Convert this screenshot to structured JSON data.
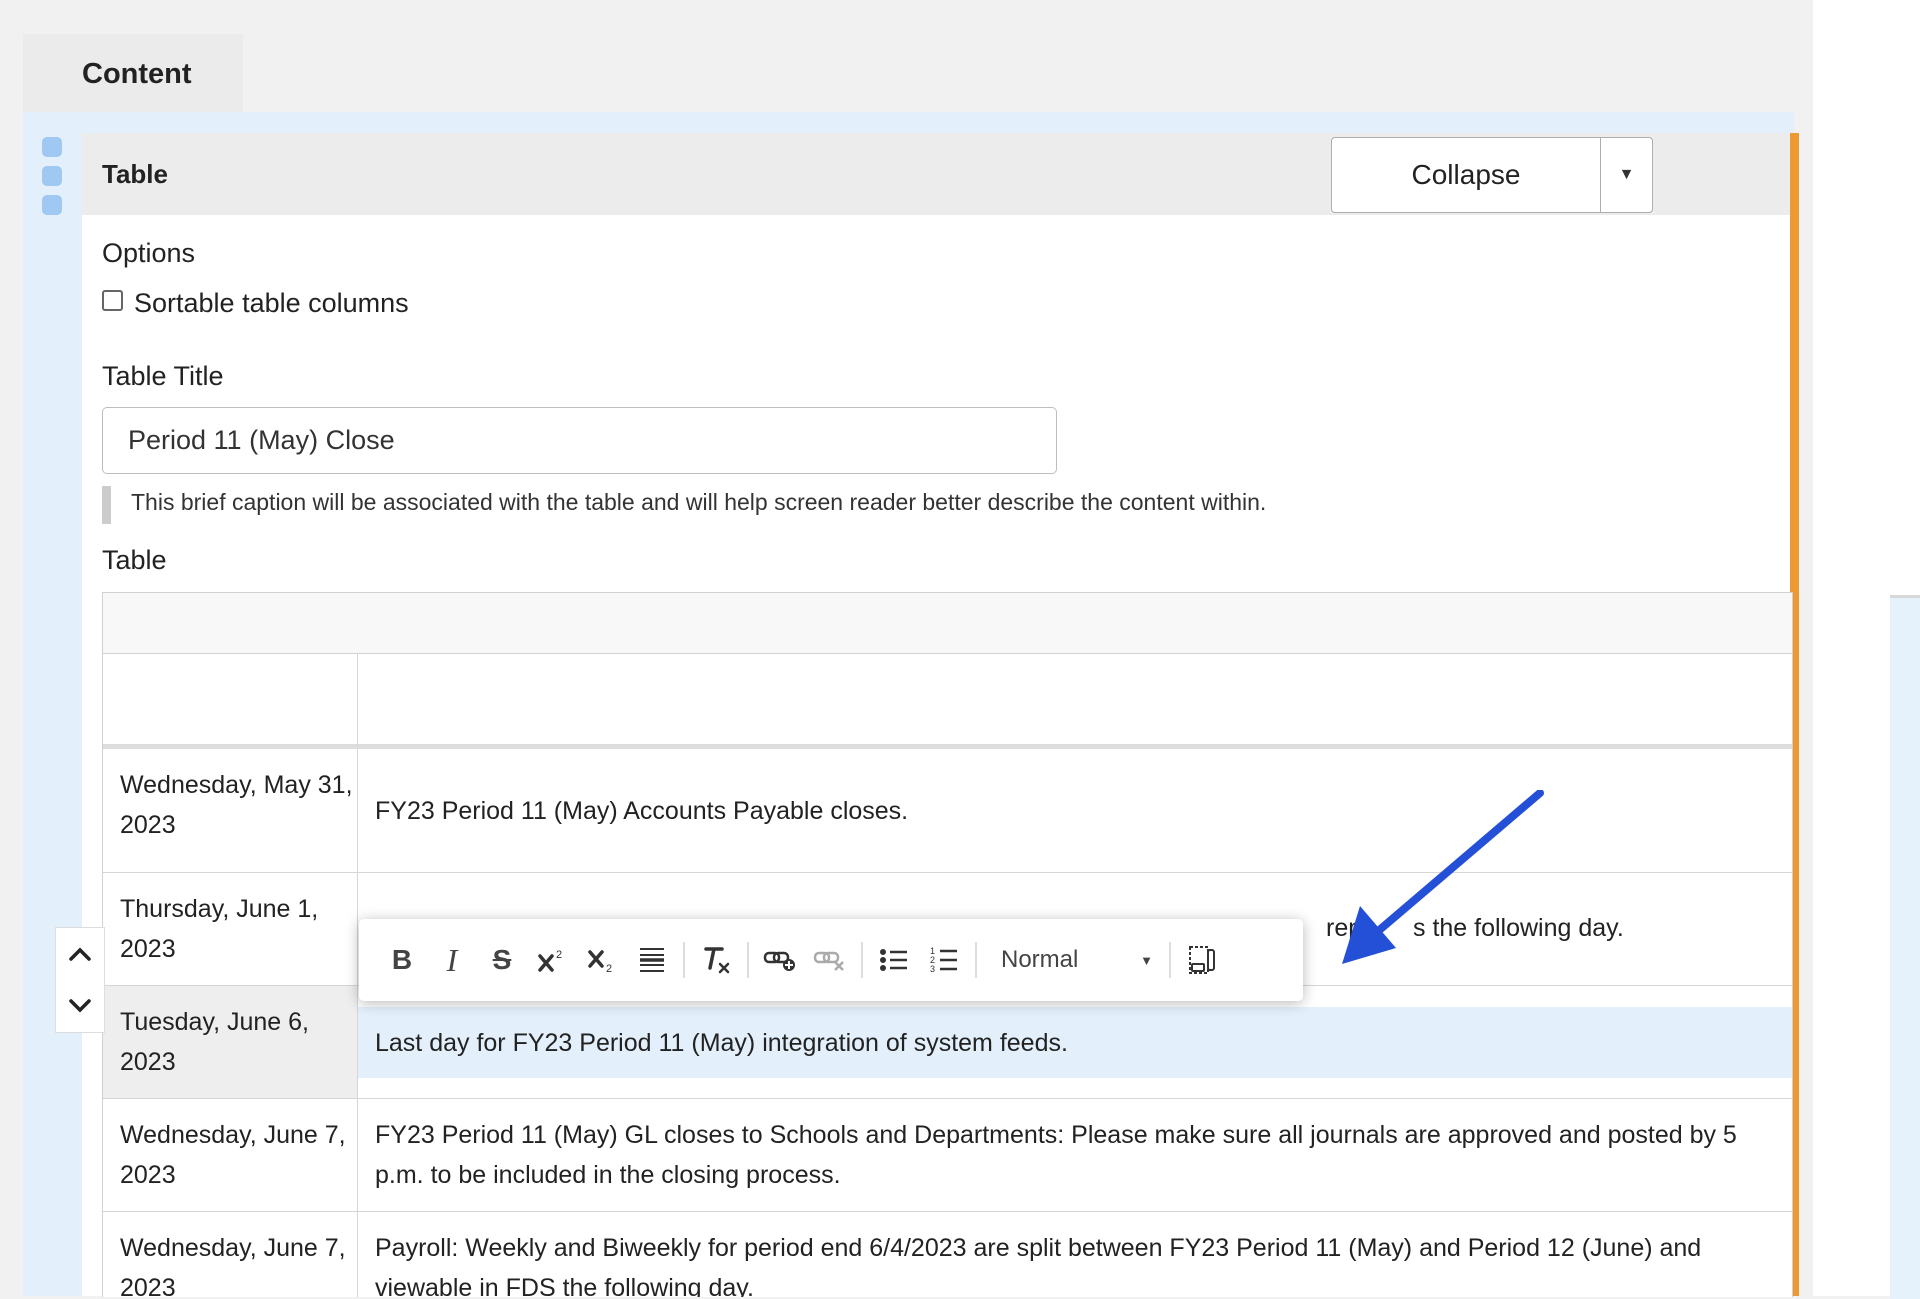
{
  "tabs": {
    "content": "Content"
  },
  "panel": {
    "title": "Table",
    "collapse_label": "Collapse"
  },
  "options": {
    "heading": "Options",
    "sortable_label": "Sortable table columns",
    "sortable_checked": false
  },
  "table_title": {
    "label": "Table Title",
    "value": "Period 11 (May) Close",
    "help": "This brief caption will be associated with the table and will help screen reader better describe the content within."
  },
  "table": {
    "label": "Table",
    "rows": [
      {
        "date": "Wednesday, May 31, 2023",
        "text": "FY23 Period 11 (May) Accounts Payable closes."
      },
      {
        "date": "Thursday, June 1, 2023",
        "text": "s the following day."
      },
      {
        "date": "Tuesday, June 6, 2023",
        "text": "Last day for FY23 Period 11 (May) integration of system feeds."
      },
      {
        "date": "Wednesday, June 7, 2023",
        "text": "FY23 Period 11 (May) GL closes to Schools and Departments: Please make sure all journals are approved and posted by 5 p.m. to be included in the closing process."
      },
      {
        "date": "Wednesday, June 7, 2023",
        "text": "Payroll: Weekly and Biweekly for period end 6/4/2023 are split between FY23 Period 11 (May) and Period 12 (June) and viewable in FDS the following day."
      }
    ],
    "partial_row2_fragment": "rep"
  },
  "toolbar": {
    "bold": "B",
    "italic": "I",
    "strike": "S",
    "format_value": "Normal",
    "icons": [
      "bold-icon",
      "italic-icon",
      "strikethrough-icon",
      "superscript-icon",
      "subscript-icon",
      "horizontal-rule-icon",
      "clear-format-icon",
      "link-icon",
      "unlink-icon",
      "bulleted-list-icon",
      "numbered-list-icon",
      "source-icon"
    ]
  },
  "colors": {
    "accent_orange": "#ee9a32",
    "light_blue": "#e3f0fb",
    "arrow_blue": "#2350d6"
  }
}
